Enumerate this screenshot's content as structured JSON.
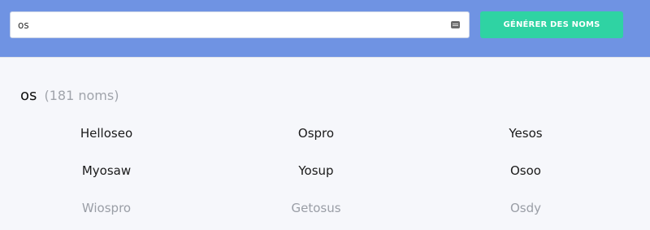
{
  "header": {
    "search": {
      "value": "os",
      "placeholder": ""
    },
    "generate_button_label": "GÉNÉRER DES NOMS",
    "keyboard_icon": "keyboard-icon"
  },
  "results": {
    "query": "os",
    "count_label": "(181 noms)",
    "rows": [
      [
        "Helloseo",
        "Ospro",
        "Yesos"
      ],
      [
        "Myosaw",
        "Yosup",
        "Osoo"
      ],
      [
        "Wiospro",
        "Getosus",
        "Osdy"
      ]
    ]
  },
  "colors": {
    "header_bg": "#6f93e3",
    "button_bg": "#2fd3a3",
    "page_bg": "#f6f7fb"
  }
}
